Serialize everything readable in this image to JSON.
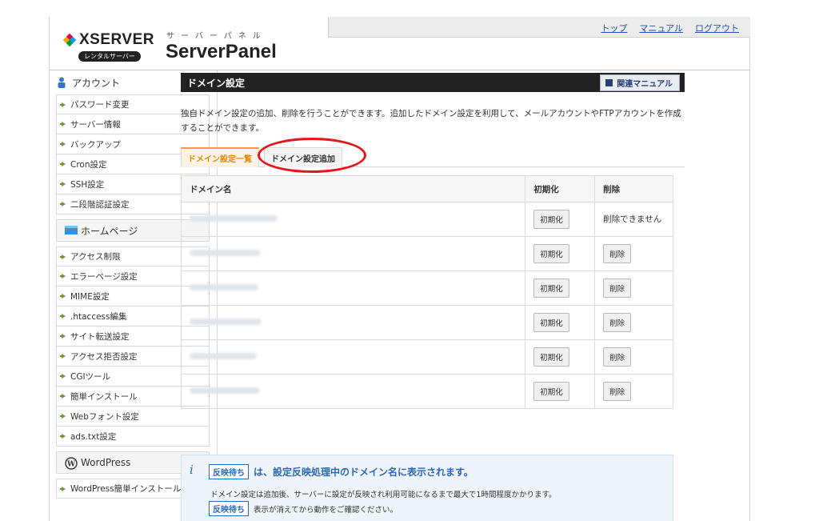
{
  "header": {
    "logo_text": "XSERVER",
    "logo_sub": "レンタルサーバー",
    "panel_small": "サーバーパネル",
    "panel_title": "ServerPanel",
    "links": {
      "top": "トップ",
      "manual": "マニュアル",
      "logout": "ログアウト"
    }
  },
  "sidebar": {
    "account": {
      "title": "アカウント",
      "items": [
        "パスワード変更",
        "サーバー情報",
        "バックアップ",
        "Cron設定",
        "SSH設定",
        "二段階認証設定"
      ]
    },
    "homepage": {
      "title": "ホームページ",
      "items": [
        "アクセス制限",
        "エラーページ設定",
        "MIME設定",
        ".htaccess編集",
        "サイト転送設定",
        "アクセス拒否設定",
        "CGIツール",
        "簡単インストール",
        "Webフォント設定",
        "ads.txt設定"
      ]
    },
    "wordpress": {
      "title": "WordPress",
      "items": [
        "WordPress簡単インストール"
      ]
    }
  },
  "main": {
    "title": "ドメイン設定",
    "manual_button": "関連マニュアル",
    "description": "独自ドメイン設定の追加、削除を行うことができます。追加したドメイン設定を利用して、メールアカウントやFTPアカウントを作成することができます。",
    "tabs": {
      "list": "ドメイン設定一覧",
      "add": "ドメイン設定追加"
    },
    "table": {
      "headers": {
        "domain": "ドメイン名",
        "init": "初期化",
        "delete": "削除"
      },
      "init_label": "初期化",
      "delete_label": "削除",
      "cannot_delete": "削除できません"
    }
  },
  "info": {
    "badge": "反映待ち",
    "heading": "は、設定反映処理中のドメイン名に表示されます。",
    "line1": "ドメイン設定は追加後、サーバーに設定が反映され利用可能になるまで最大で1時間程度かかります。",
    "line2": "表示が消えてから動作をご確認ください。"
  },
  "colors": {
    "accent_orange": "#e2870c",
    "highlight_red": "#e8141a",
    "info_blue": "#2c69b5"
  }
}
